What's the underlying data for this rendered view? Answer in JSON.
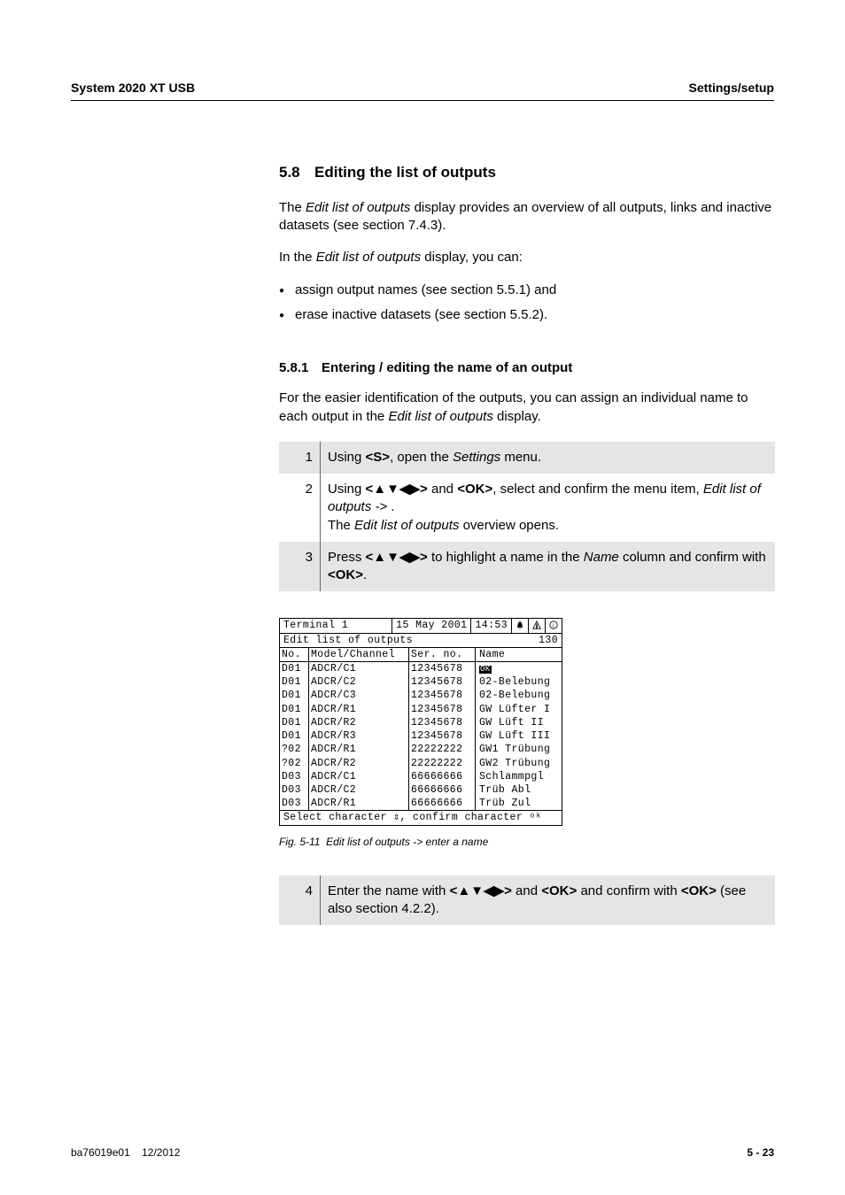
{
  "header": {
    "left": "System 2020 XT USB",
    "right": "Settings/setup"
  },
  "section": {
    "number": "5.8",
    "title": "Editing the list of outputs"
  },
  "intro": {
    "line1_prefix": "The ",
    "line1_italic": "Edit list of outputs",
    "line1_suffix": " display provides an overview of all outputs, links and inactive datasets (see section 7.4.3).",
    "line2_prefix": "In the ",
    "line2_italic": "Edit list of outputs",
    "line2_suffix": " display, you can:"
  },
  "bullets": [
    "assign output names (see section 5.5.1) and",
    "erase inactive datasets (see section 5.5.2)."
  ],
  "subsection": {
    "number": "5.8.1",
    "title": "Entering / editing the name of an output"
  },
  "subintro": {
    "prefix": "For the easier identification of the outputs, you can assign an individual name to each output in the ",
    "italic": "Edit list of outputs",
    "suffix": " display."
  },
  "steps1": [
    {
      "n": "1",
      "segments": [
        "Using ",
        {
          "b": "<S>"
        },
        ", open the ",
        {
          "i": "Settings"
        },
        " menu."
      ]
    },
    {
      "n": "2",
      "segments": [
        "Using ",
        {
          "b": "<▲▼◀▶>"
        },
        " and ",
        {
          "b": "<OK>"
        },
        ", select and confirm the menu item, ",
        {
          "i": "Edit list of outputs ->"
        },
        " .",
        {
          "br": true
        },
        "The ",
        {
          "i": "Edit list of outputs"
        },
        " overview opens."
      ]
    },
    {
      "n": "3",
      "segments": [
        "Press ",
        {
          "b": "<▲▼◀▶>"
        },
        " to highlight a name in the ",
        {
          "i": "Name"
        },
        " column and confirm with ",
        {
          "b": "<OK>"
        },
        "."
      ]
    }
  ],
  "screen": {
    "top": {
      "terminal": "Terminal 1",
      "date": "15 May 2001",
      "time": "14:53"
    },
    "subtitle_left": "Edit list of outputs",
    "subtitle_right": "130",
    "columns": {
      "no": "No.",
      "model": "Model/Channel",
      "ser": "Ser. no.",
      "name": "Name"
    },
    "rows": [
      {
        "no": "D01",
        "model": "ADCR/C1",
        "ser": "12345678",
        "name": "",
        "cursor": true
      },
      {
        "no": "D01",
        "model": "ADCR/C2",
        "ser": "12345678",
        "name": "02-Belebung"
      },
      {
        "no": "D01",
        "model": "ADCR/C3",
        "ser": "12345678",
        "name": "02-Belebung"
      },
      {
        "no": "D01",
        "model": "ADCR/R1",
        "ser": "12345678",
        "name": "GW Lüfter I"
      },
      {
        "no": "D01",
        "model": "ADCR/R2",
        "ser": "12345678",
        "name": "GW Lüft II"
      },
      {
        "no": "D01",
        "model": "ADCR/R3",
        "ser": "12345678",
        "name": "GW Lüft III"
      },
      {
        "no": "?02",
        "model": "ADCR/R1",
        "ser": "22222222",
        "name": "GW1 Trübung"
      },
      {
        "no": "?02",
        "model": "ADCR/R2",
        "ser": "22222222",
        "name": "GW2 Trübung"
      },
      {
        "no": "D03",
        "model": "ADCR/C1",
        "ser": "66666666",
        "name": "Schlammpgl"
      },
      {
        "no": "D03",
        "model": "ADCR/C2",
        "ser": "66666666",
        "name": "Trüb Abl"
      },
      {
        "no": "D03",
        "model": "ADCR/R1",
        "ser": "66666666",
        "name": "Trüb Zul"
      }
    ],
    "footer": "Select character ⇕, confirm character ᵒᵏ"
  },
  "caption": {
    "label": "Fig. 5-11",
    "text": "Edit list of outputs -> enter a name"
  },
  "steps2": [
    {
      "n": "4",
      "segments": [
        "Enter the name with ",
        {
          "b": "<▲▼◀▶>"
        },
        " and ",
        {
          "b": "<OK>"
        },
        " and confirm with ",
        {
          "b": "<OK>"
        },
        " (see also section 4.2.2)."
      ]
    }
  ],
  "footer": {
    "left1": "ba76019e01",
    "left2": "12/2012",
    "right": "5 - 23"
  }
}
